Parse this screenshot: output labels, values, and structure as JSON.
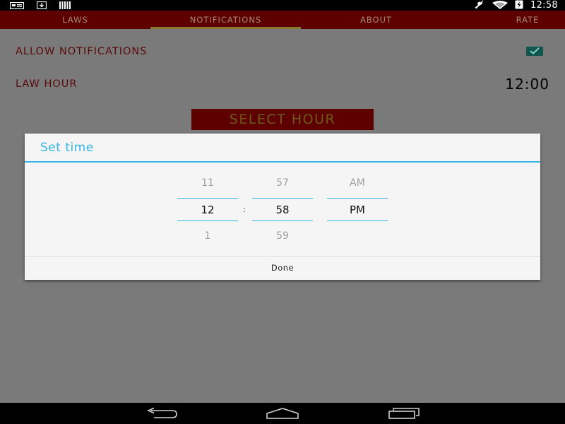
{
  "status_bar": {
    "time": "12:58",
    "icons": [
      "notification-card-icon",
      "download-icon",
      "barcode-icon",
      "mute-icon",
      "wifi-icon",
      "battery-charging-icon"
    ]
  },
  "tabs": [
    {
      "label": "LAWS",
      "selected": false
    },
    {
      "label": "NOTIFICATIONS",
      "selected": true
    },
    {
      "label": "ABOUT",
      "selected": false
    },
    {
      "label": "RATE",
      "selected": false
    }
  ],
  "settings": {
    "allow_notifications_label": "ALLOW NOTIFICATIONS",
    "allow_notifications_checked": true,
    "law_hour_label": "LAW HOUR",
    "law_hour_value": "12:00",
    "select_hour_button": "SELECT HOUR"
  },
  "dialog": {
    "title": "Set time",
    "hour": {
      "prev": "11",
      "current": "12",
      "next": "1"
    },
    "minute": {
      "prev": "57",
      "current": "58",
      "next": "59"
    },
    "ampm": {
      "prev": "AM",
      "current": "PM"
    },
    "separator": ":",
    "done_label": "Done"
  },
  "colors": {
    "accent": "#33b5e5",
    "app_bar": "#5e0000",
    "checkbox": "#0e564f"
  },
  "nav_bar": {
    "buttons": [
      "back-icon",
      "home-icon",
      "recents-icon"
    ]
  }
}
